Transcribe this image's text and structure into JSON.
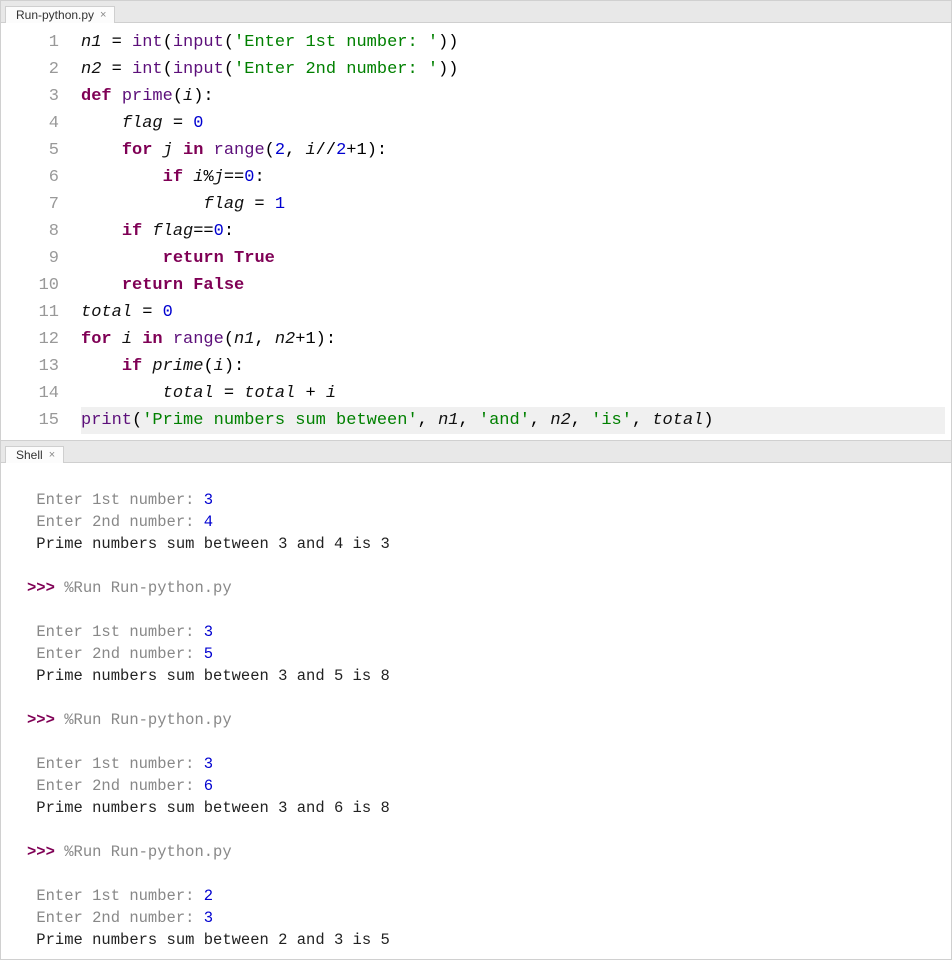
{
  "editor": {
    "tab_label": "Run-python.py",
    "lines": [
      1,
      2,
      3,
      4,
      5,
      6,
      7,
      8,
      9,
      10,
      11,
      12,
      13,
      14,
      15
    ],
    "tokens": {
      "n1": "n1",
      "n2": "n2",
      "eq": " = ",
      "int": "int",
      "input": "input",
      "s1": "'Enter 1st number: '",
      "s2": "'Enter 2nd number: '",
      "def": "def",
      "prime": "prime",
      "i": "i",
      "j": "j",
      "flag": "flag",
      "zero": "0",
      "one": "1",
      "two": "2",
      "for": "for",
      "in": "in",
      "range": "range",
      "half": "//",
      "plus1": "+1",
      "if": "if",
      "mod": "%",
      "eqeq": "==",
      "return": "return",
      "True": "True",
      "False": "False",
      "total": "total",
      "plus": " + ",
      "print": "print",
      "s_prime": "'Prime numbers sum between'",
      "s_and": "'and'",
      "s_is": "'is'",
      "comma": ", "
    }
  },
  "shell": {
    "tab_label": "Shell",
    "prompt_chev": ">>> ",
    "run_cmd": "%Run Run-python.py",
    "prompt1_label": "Enter 1st number: ",
    "prompt2_label": "Enter 2nd number: ",
    "out_prefix": "Prime numbers sum between ",
    "out_and": " and ",
    "out_is": " is ",
    "runs": [
      {
        "n1": "3",
        "n2": "4",
        "sum": "3",
        "show_cmd": false
      },
      {
        "n1": "3",
        "n2": "5",
        "sum": "8",
        "show_cmd": true
      },
      {
        "n1": "3",
        "n2": "6",
        "sum": "8",
        "show_cmd": true
      },
      {
        "n1": "2",
        "n2": "3",
        "sum": "5",
        "show_cmd": true
      }
    ]
  }
}
